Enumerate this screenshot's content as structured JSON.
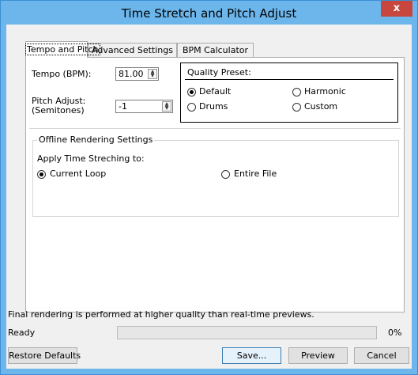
{
  "window": {
    "title": "Time Stretch and Pitch Adjust",
    "close_glyph": "x"
  },
  "tabs": [
    {
      "label": "Tempo and Pitch",
      "active": true
    },
    {
      "label": "Advanced Settings",
      "active": false
    },
    {
      "label": "BPM Calculator",
      "active": false
    }
  ],
  "tempo": {
    "label": "Tempo (BPM):",
    "value": "81.00"
  },
  "pitch": {
    "label_line1": "Pitch Adjust:",
    "label_line2": "(Semitones)",
    "value": "-1"
  },
  "quality": {
    "title": "Quality Preset:",
    "options": [
      {
        "label": "Default",
        "selected": true
      },
      {
        "label": "Harmonic",
        "selected": false
      },
      {
        "label": "Drums",
        "selected": false
      },
      {
        "label": "Custom",
        "selected": false
      }
    ]
  },
  "offline": {
    "title": "Offline Rendering Settings",
    "apply_label": "Apply Time Streching to:",
    "options": [
      {
        "label": "Current Loop",
        "selected": true
      },
      {
        "label": "Entire File",
        "selected": false
      }
    ]
  },
  "footer": {
    "note": "Final rendering is performed at higher quality than real-time previews.",
    "status": "Ready",
    "progress_percent": 0,
    "progress_label": "0%"
  },
  "buttons": {
    "restore": "Restore Defaults",
    "save": "Save...",
    "preview": "Preview",
    "cancel": "Cancel"
  }
}
